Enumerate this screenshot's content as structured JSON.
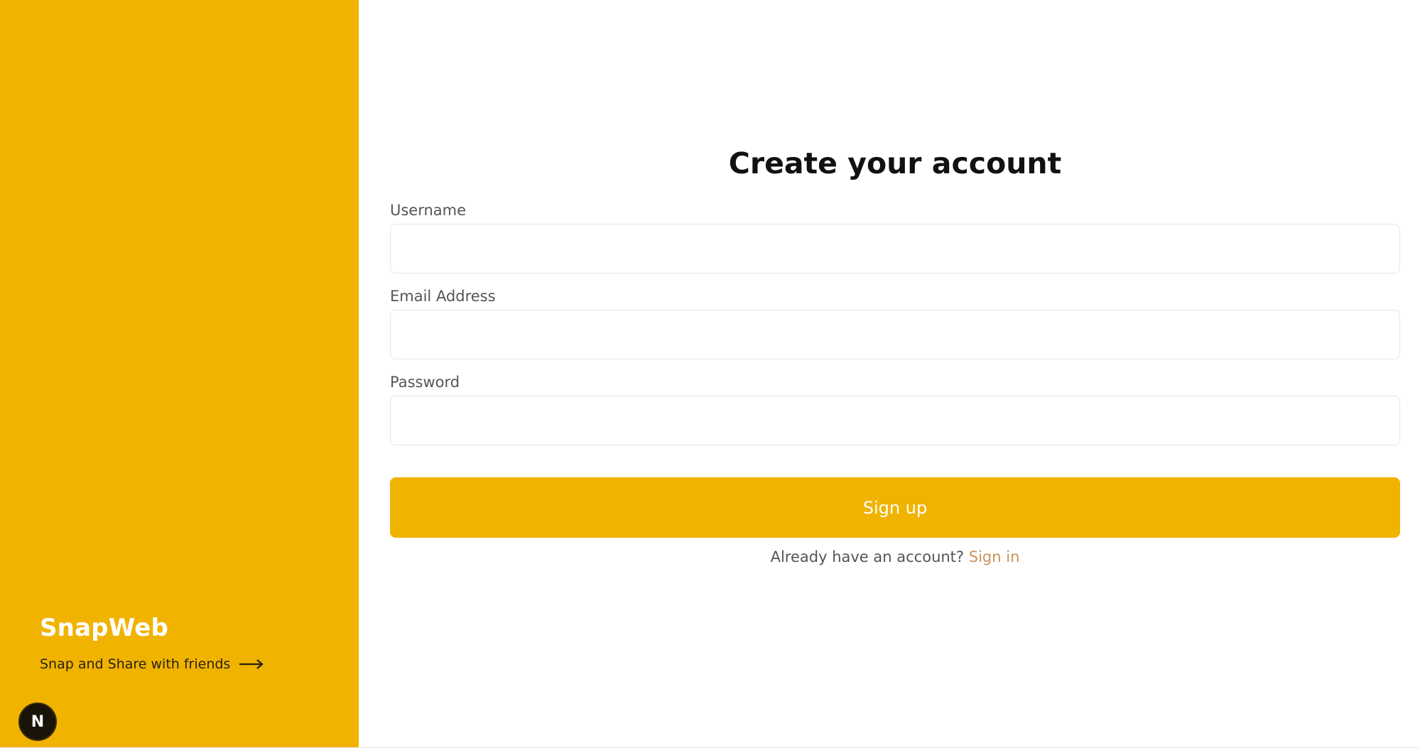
{
  "brand": {
    "name": "SnapWeb",
    "tagline": "Snap and Share with friends",
    "badge_letter": "N"
  },
  "form": {
    "title": "Create your account",
    "fields": [
      {
        "label": "Username",
        "value": "",
        "type": "text"
      },
      {
        "label": "Email Address",
        "value": "",
        "type": "email"
      },
      {
        "label": "Password",
        "value": "",
        "type": "password"
      }
    ],
    "submit_label": "Sign up",
    "signin_prompt": "Already have an account?",
    "signin_link": "Sign in"
  },
  "colors": {
    "accent": "#F0B300",
    "link": "#C9935A",
    "badge": "#1a1408"
  },
  "icons": {
    "tagline_arrow": "arrow-right-icon",
    "badge": "nextjs-logo-icon"
  }
}
